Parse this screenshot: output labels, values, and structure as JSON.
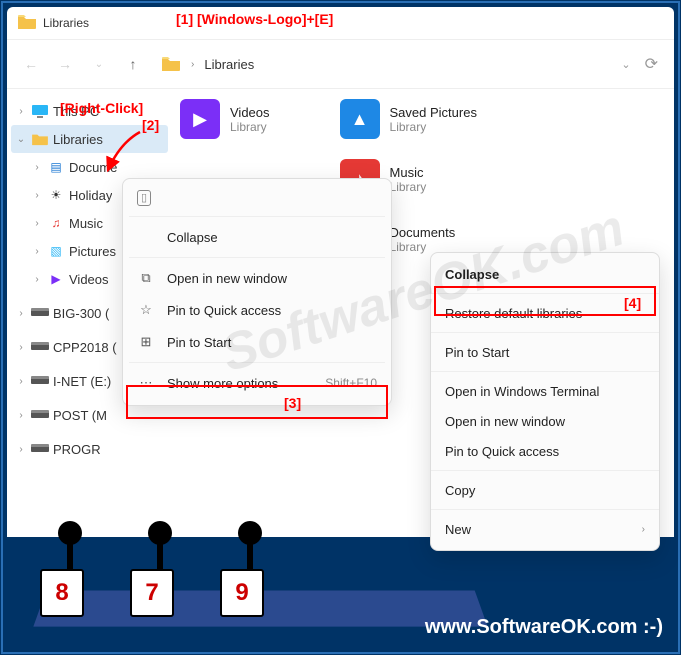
{
  "titlebar": {
    "title": "Libraries"
  },
  "navbar": {
    "breadcrumb": "Libraries"
  },
  "tree": {
    "items": [
      {
        "label": "This PC",
        "chev": ">",
        "iconType": "pc"
      },
      {
        "label": "Libraries",
        "chev": "v",
        "iconType": "folder",
        "selected": true
      },
      {
        "label": "Docume",
        "chev": ">",
        "iconType": "doc",
        "indent": 1
      },
      {
        "label": "Holiday",
        "chev": ">",
        "iconType": "sun",
        "indent": 1
      },
      {
        "label": "Music",
        "chev": ">",
        "iconType": "music",
        "indent": 1
      },
      {
        "label": "Pictures",
        "chev": ">",
        "iconType": "pic",
        "indent": 1
      },
      {
        "label": "Videos",
        "chev": ">",
        "iconType": "video",
        "indent": 1
      },
      {
        "label": "BIG-300 (",
        "chev": ">",
        "iconType": "drive"
      },
      {
        "label": "CPP2018 (",
        "chev": ">",
        "iconType": "drive"
      },
      {
        "label": "I-NET (E:)",
        "chev": ">",
        "iconType": "drive"
      },
      {
        "label": "POST (M",
        "chev": ">",
        "iconType": "drive"
      },
      {
        "label": "PROGR",
        "chev": ">",
        "iconType": "drive"
      }
    ]
  },
  "libraries": {
    "left": [
      {
        "name": "Videos",
        "sub": "Library",
        "color": "#7b2ff7",
        "glyph": "▶"
      }
    ],
    "right": [
      {
        "name": "Saved Pictures",
        "sub": "Library",
        "color": "#1e88e5",
        "glyph": "▲"
      },
      {
        "name": "Music",
        "sub": "Library",
        "color": "#e53935",
        "glyph": "♪"
      },
      {
        "name": "Documents",
        "sub": "Library",
        "color": "#1e88e5",
        "glyph": "≡"
      }
    ]
  },
  "ctx1": {
    "collapse": "Collapse",
    "open_new": "Open in new window",
    "pin_quick": "Pin to Quick access",
    "pin_start": "Pin to Start",
    "show_more": "Show more options",
    "show_more_sc": "Shift+F10"
  },
  "ctx2": {
    "collapse": "Collapse",
    "restore": "Restore default libraries",
    "pin_start": "Pin to Start",
    "open_terminal": "Open in Windows Terminal",
    "open_new": "Open in new window",
    "pin_quick": "Pin to Quick access",
    "copy": "Copy",
    "new": "New"
  },
  "anno": {
    "a1": "[1]  [Windows-Logo]+[E]",
    "a2_label": "[Right-Click]",
    "a2_num": "[2]",
    "a3": "[3]",
    "a4": "[4]"
  },
  "footer": {
    "url": "www.SoftwareOK.com :-)",
    "watermark": "SoftwareOK.com",
    "boxes": [
      "8",
      "7",
      "9"
    ]
  }
}
